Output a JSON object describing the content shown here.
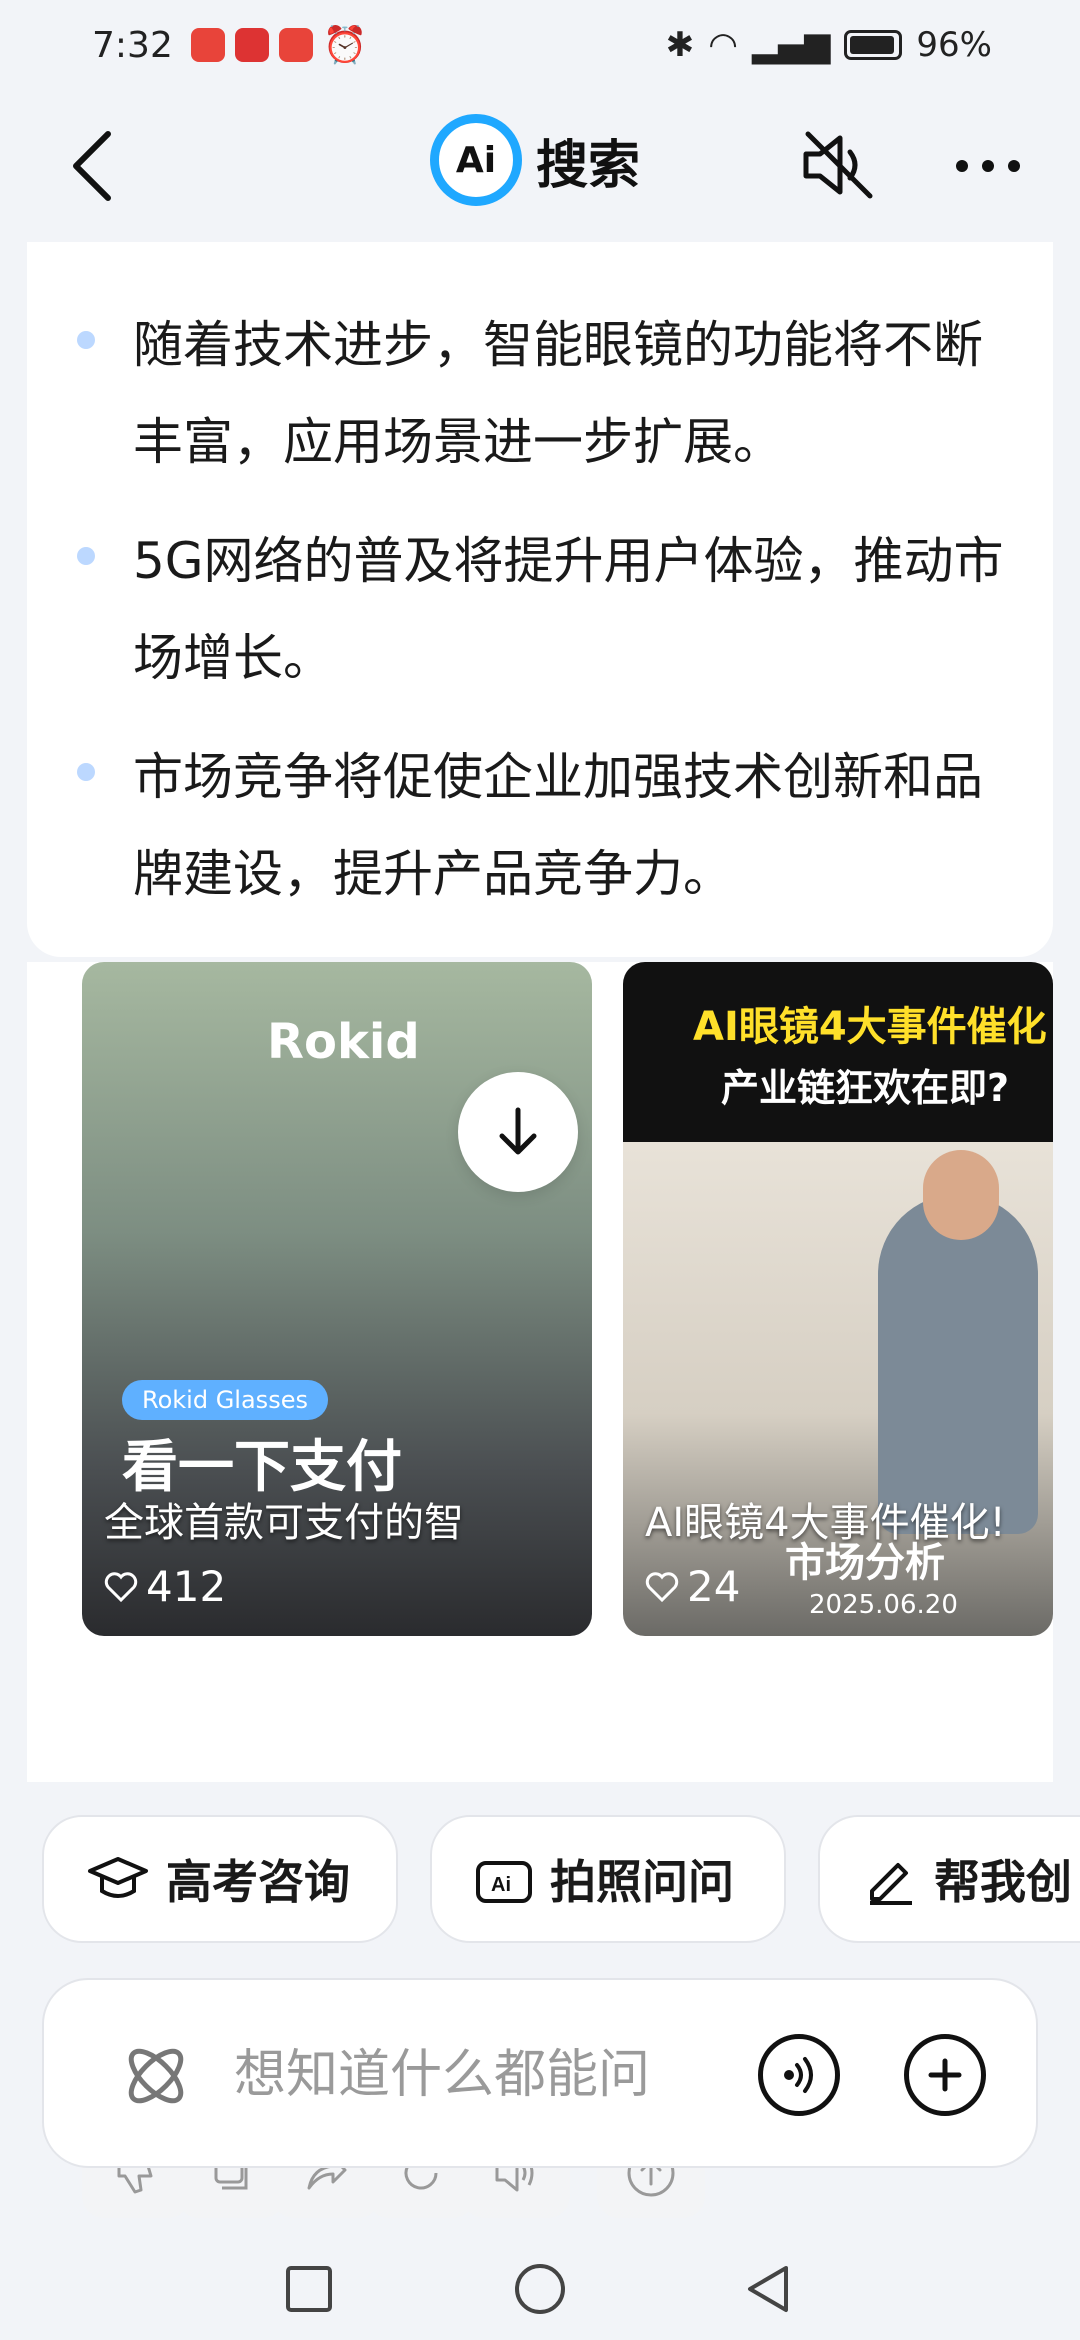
{
  "status_bar": {
    "time": "7:32",
    "battery": "96%"
  },
  "header": {
    "brand_badge": "Ai",
    "title": "搜索"
  },
  "answer": {
    "bullets": [
      {
        "text": "随着技术进步，智能眼镜的功能将不断丰富，应用场景进一步扩展。"
      },
      {
        "text": "5G网络的普及将提升用户体验，推动市场增长。"
      },
      {
        "text": "市场竞争将促使企业加强技术创新和品牌建设，提升产品竞争力。"
      }
    ]
  },
  "videos": [
    {
      "brand": "Rokid",
      "tag": "Rokid Glasses",
      "overlay": "看一下支付",
      "caption": "全球首款可支付的智",
      "likes": "412"
    },
    {
      "headline_1": "AI眼镜4大事件催化",
      "headline_2": "产业链狂欢在即?",
      "caption": "AI眼镜4大事件催化!",
      "sub": "市场分析",
      "date": "2025.06.20",
      "likes": "24"
    }
  ],
  "chips": [
    {
      "label": "高考咨询",
      "icon": "graduation-cap-icon"
    },
    {
      "label": "拍照问问",
      "icon": "camera-ai-icon"
    },
    {
      "label": "帮我创",
      "icon": "pen-icon"
    }
  ],
  "input": {
    "placeholder": "想知道什么都能问"
  },
  "colors": {
    "accent": "#1fa8ff",
    "bullet": "#bcd8ff",
    "background": "#f2f4f8"
  }
}
